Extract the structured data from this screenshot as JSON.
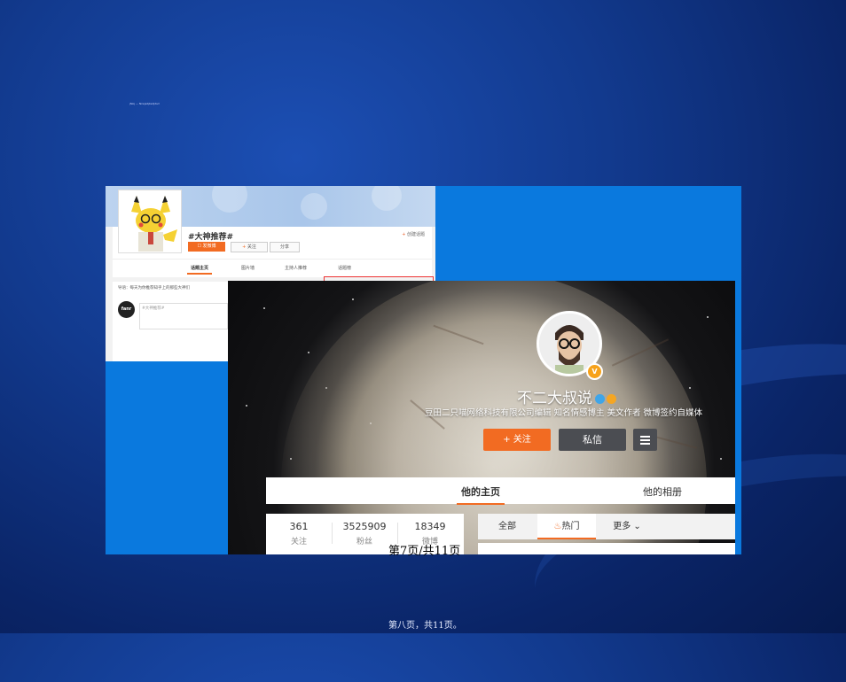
{
  "slide": {
    "tiny_title": "jfskj — Nrwjsdjbsdjdsd",
    "page_number": "第7页/共11页",
    "footer": "第八页，共11页。"
  },
  "topic_page": {
    "title": "#大神推荐#",
    "create_link": "创建话题",
    "buttons": {
      "publish": "发微博",
      "follow": "关注",
      "share": "分享"
    },
    "tabs": [
      "话题主页",
      "图片墙",
      "主持人推荐",
      "话题榜"
    ],
    "guide": "导语：每天为你推荐知乎上的那些大神们",
    "avatar_text": "fanr",
    "post_placeholder": "#大神推荐#"
  },
  "profile_page": {
    "name": "不二大叔说",
    "description": "豆田二只喵网络科技有限公司编辑 知名情感博主 美文作者 微博签约自媒体",
    "follow_label": "+ 关注",
    "message_label": "私信",
    "tabs": [
      "他的主页",
      "他的相册"
    ],
    "stats": [
      {
        "value": "361",
        "label": "关注"
      },
      {
        "value": "3525909",
        "label": "粉丝"
      },
      {
        "value": "18349",
        "label": "微博"
      }
    ],
    "feed_tabs": {
      "all": "全部",
      "hot": "热门",
      "more": "更多"
    },
    "colors": {
      "accent": "#f26b22",
      "dark_button": "#4b4d52"
    }
  }
}
